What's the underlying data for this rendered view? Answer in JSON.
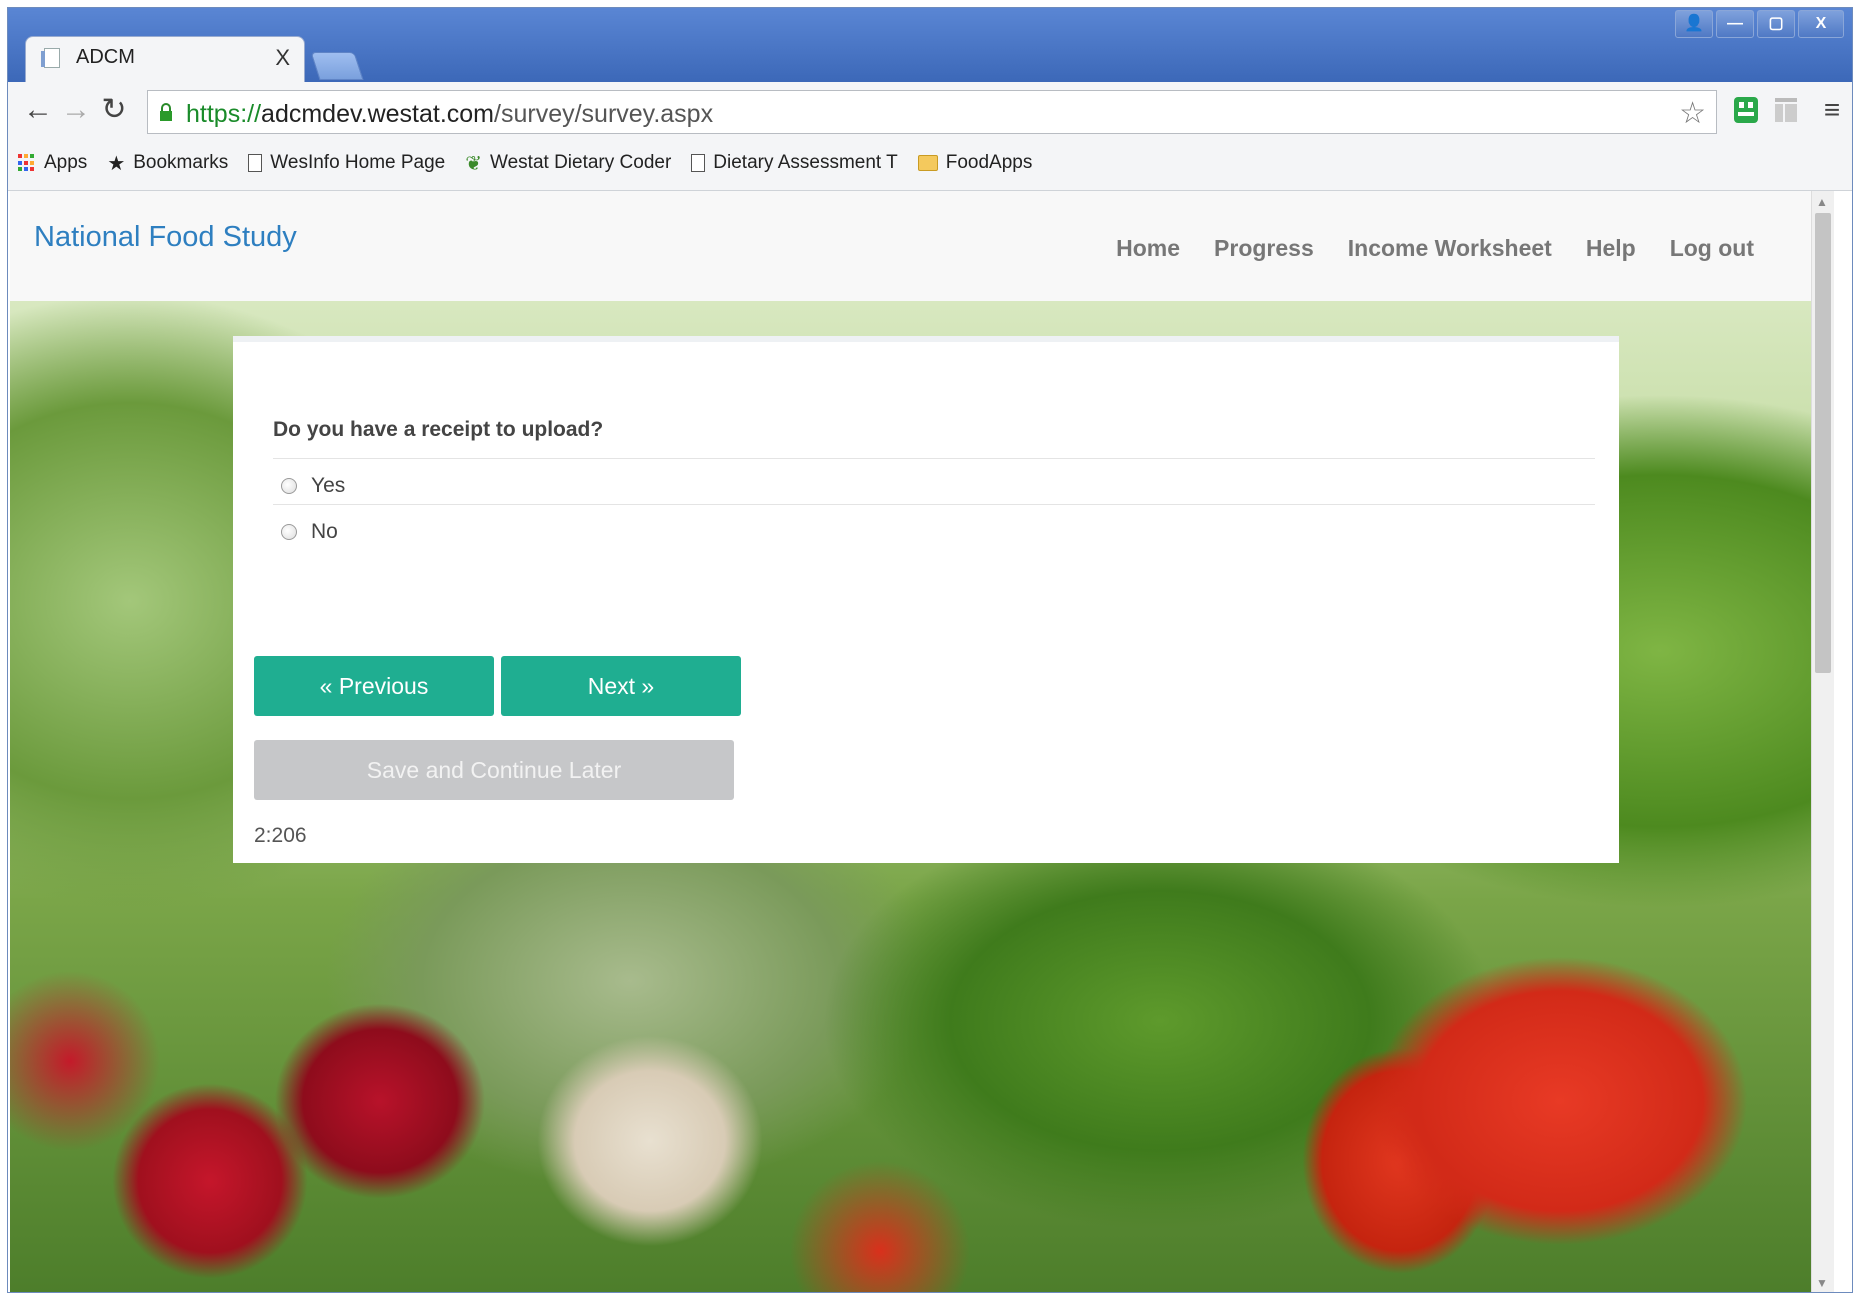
{
  "browser": {
    "tab_title": "ADCM",
    "tab_close": "X",
    "window_buttons": {
      "user": "👤",
      "minimize": "—",
      "maximize": "▢",
      "close": "X"
    },
    "url_scheme": "https://",
    "url_host": "adcmdev.westat.com",
    "url_path": "/survey/survey.aspx",
    "bookmarks": [
      {
        "label": "Apps",
        "icon": "apps-grid-icon"
      },
      {
        "label": "Bookmarks",
        "icon": "star-icon"
      },
      {
        "label": "WesInfo Home Page",
        "icon": "page-icon"
      },
      {
        "label": "Westat Dietary Coder",
        "icon": "leaf-icon"
      },
      {
        "label": "Dietary Assessment T",
        "icon": "page-icon"
      },
      {
        "label": "FoodApps",
        "icon": "folder-icon"
      }
    ]
  },
  "site": {
    "brand": "National Food Study",
    "nav": [
      "Home",
      "Progress",
      "Income Worksheet",
      "Help",
      "Log out"
    ]
  },
  "survey": {
    "question": "Do you have a receipt to upload?",
    "options": [
      "Yes",
      "No"
    ],
    "selected": null,
    "prev_label": "« Previous",
    "next_label": "Next »",
    "save_label": "Save and Continue Later",
    "question_id": "2:206"
  },
  "colors": {
    "brand": "#2e7fc0",
    "primary_button": "#1fae91",
    "disabled_button": "#c6c7c9",
    "title_bar": "#4a77c8"
  }
}
